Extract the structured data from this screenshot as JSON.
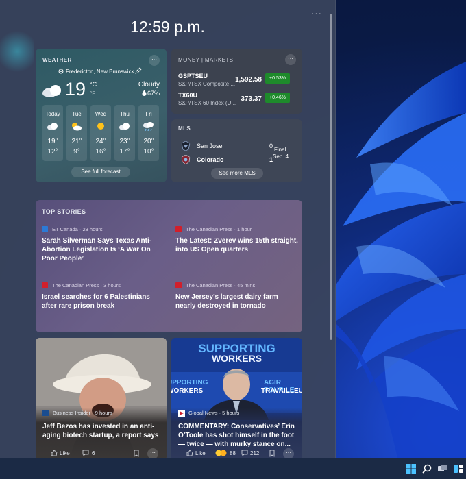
{
  "panel": {
    "time": "12:59 p.m.",
    "more_label": "···"
  },
  "weather": {
    "title": "WEATHER",
    "location": "Fredericton, New Brunswick",
    "temp": "19",
    "unit_c": "°C",
    "unit_f": "°F",
    "condition": "Cloudy",
    "humidity": "67%",
    "forecast": [
      {
        "day": "Today",
        "hi": "19°",
        "lo": "12°",
        "icon": "cloud-icon"
      },
      {
        "day": "Tue",
        "hi": "21°",
        "lo": "9°",
        "icon": "partly-sunny-icon"
      },
      {
        "day": "Wed",
        "hi": "24°",
        "lo": "16°",
        "icon": "sun-icon"
      },
      {
        "day": "Thu",
        "hi": "23°",
        "lo": "17°",
        "icon": "cloud-icon"
      },
      {
        "day": "Fri",
        "hi": "20°",
        "lo": "10°",
        "icon": "rain-icon"
      }
    ],
    "button": "See full forecast"
  },
  "money": {
    "title": "MONEY | MARKETS",
    "stocks": [
      {
        "symbol": "GSPTSEU",
        "name": "S&P/TSX Composite ...",
        "price": "1,592.58",
        "change": "+0.53%"
      },
      {
        "symbol": "TX60U",
        "name": "S&P/TSX 60 Index (U...",
        "price": "373.37",
        "change": "+0.46%"
      }
    ]
  },
  "mls": {
    "title": "MLS",
    "teams": [
      {
        "name": "San Jose",
        "score": "0"
      },
      {
        "name": "Colorado",
        "score": "1"
      }
    ],
    "status": "Final",
    "date": "Sep. 4",
    "button": "See more MLS"
  },
  "top_stories": {
    "title": "TOP STORIES",
    "stories": [
      {
        "source": "ET Canada · 23 hours",
        "headline": "Sarah Silverman Says Texas Anti-Abortion Legislation Is ‘A War On Poor People’"
      },
      {
        "source": "The Canadian Press · 1 hour",
        "headline": "The Latest: Zverev wins 15th straight, into US Open quarters"
      },
      {
        "source": "The Canadian Press · 3 hours",
        "headline": "Israel searches for 6 Palestinians after rare prison break"
      },
      {
        "source": "The Canadian Press · 45 mins",
        "headline": "New Jersey’s largest dairy farm nearly destroyed in tornado"
      }
    ]
  },
  "news_cards": [
    {
      "source": "Business Insider · 9 hours",
      "headline": "Jeff Bezos has invested in an anti-aging biotech startup, a report says",
      "like": "Like",
      "comments": "6"
    },
    {
      "banner_line1": "SUPPORTING",
      "banner_line2": "WORKERS",
      "side_left": "UPPORTING",
      "side_left2": "WORKERS",
      "side_right": "AGIR POUR LE",
      "side_right2": "TRAVAILLEU",
      "source": "Global News · 5 hours",
      "headline": "COMMENTARY: Conservatives’ Erin O’Toole has shot himself in the foot — twice — with murky stance on...",
      "like": "Like",
      "reactions": "88",
      "comments": "212"
    }
  ],
  "taskbar": {
    "icons": [
      "start-icon",
      "search-icon",
      "task-view-icon",
      "widgets-icon"
    ]
  }
}
